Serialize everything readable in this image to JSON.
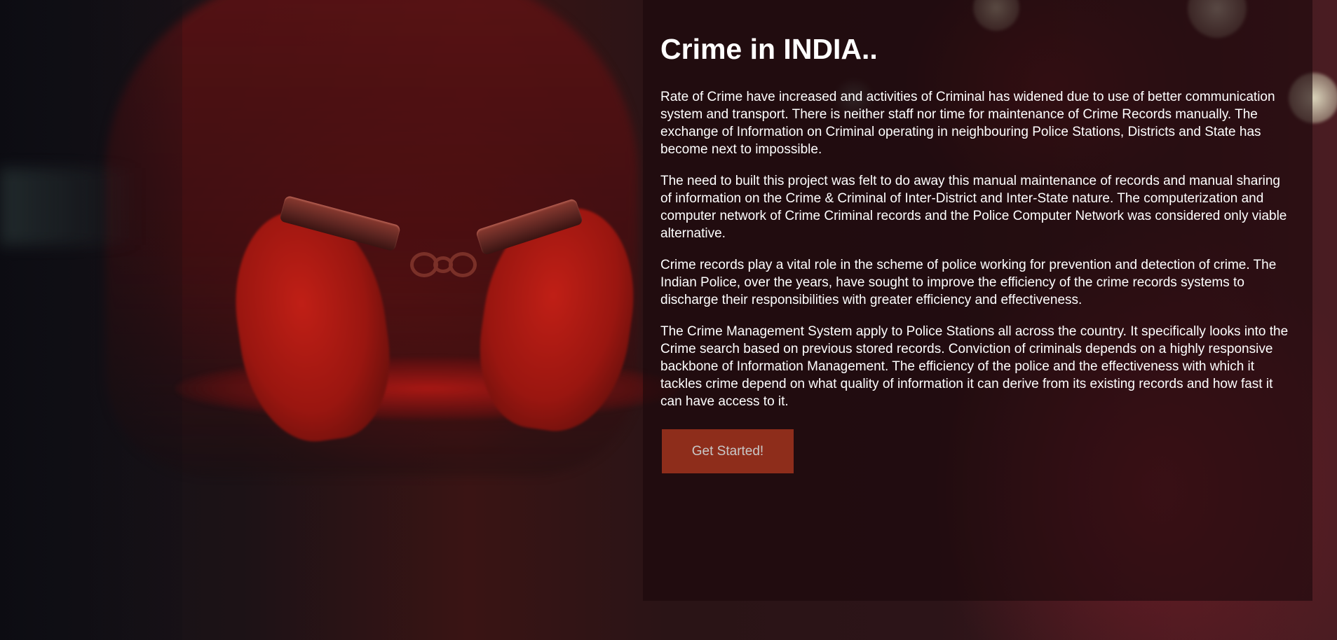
{
  "hero": {
    "background_image": "red-tinted photo of handcuffed hands behind back",
    "colors": {
      "panel_overlay": "#1c080c",
      "button_background": "#8e2d1b",
      "button_text": "#c8c8c8",
      "text": "#ffffff"
    }
  },
  "content": {
    "title": "Crime in INDIA..",
    "paragraphs": [
      "Rate of Crime have increased and activities of Criminal has widened due to use of better communication system and transport. There is neither staff nor time for maintenance of Crime Records manually. The exchange of Information on Criminal operating in neighbouring Police Stations, Districts and State has become next to impossible.",
      "The need to built this project was felt to do away this manual maintenance of records and manual sharing of information on the Crime & Criminal of Inter-District and Inter-State nature. The computerization and computer network of Crime Criminal records and the Police Computer Network was considered only viable alternative.",
      "Crime records play a vital role in the scheme of police working for prevention and detection of crime. The Indian Police, over the years, have sought to improve the efficiency of the crime records systems to discharge their responsibilities with greater efficiency and effectiveness.",
      "The Crime Management System apply to Police Stations all across the country. It specifically looks into the Crime search based on previous stored records. Conviction of criminals depends on a highly responsive backbone of Information Management. The efficiency of the police and the effectiveness with which it tackles crime depend on what quality of information it can derive from its existing records and how fast it can have access to it."
    ],
    "cta_label": "Get Started!"
  }
}
